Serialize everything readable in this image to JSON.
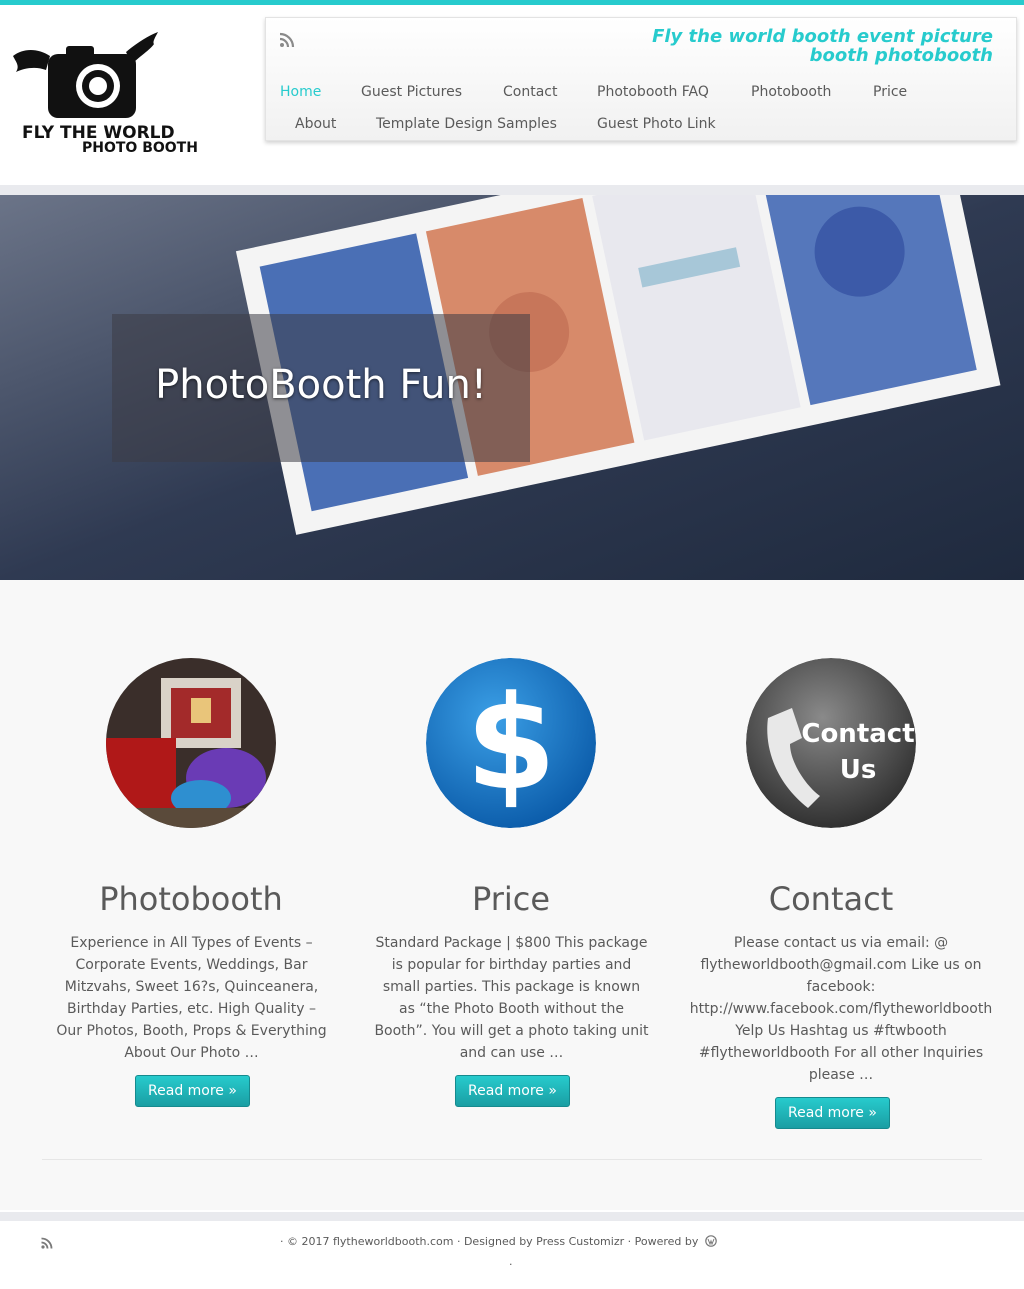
{
  "header": {
    "logo_line1": "FLY THE WORLD",
    "logo_line2": "PHOTO BOOTH",
    "tagline": "Fly the world booth event picture booth photobooth",
    "nav": {
      "home": "Home",
      "guest_pictures": "Guest Pictures",
      "contact": "Contact",
      "faq": "Photobooth FAQ",
      "photobooth": "Photobooth",
      "price": "Price",
      "about": "About",
      "templates": "Template Design Samples",
      "guest_photo_link": "Guest Photo Link"
    },
    "rss_icon": "rss-icon",
    "accent": "#27cbcd"
  },
  "hero": {
    "caption": "PhotoBooth Fun!"
  },
  "featured": [
    {
      "title": "Photobooth",
      "text": "Experience in All Types of Events – Corporate Events, Weddings, Bar Mitzvahs, Sweet 16?s, Quinceanera, Birthday Parties, etc. High Quality – Our Photos, Booth, Props & Everything About Our Photo …",
      "button": "Read more »"
    },
    {
      "title": "Price",
      "text": "Standard Package | $800 This package is popular for birthday parties and small parties. This package is known as “the Photo Booth without the Booth”. You will get a photo taking unit and can use …",
      "button": "Read more »",
      "icon_text": "$"
    },
    {
      "title": "Contact",
      "text": "Please contact us via email: @ flytheworldbooth@gmail.com Like us on facebook: http://www.facebook.com/flytheworldbooth Yelp Us Hashtag us #ftwbooth #flytheworldbooth For all other Inquiries please …",
      "button": "Read more »",
      "icon_line1": "Contact",
      "icon_line2": "Us"
    }
  ],
  "footer": {
    "text": "·  © 2017 flytheworldbooth.com ·  Designed by Press Customizr ·  Powered by",
    "dot": "·",
    "wordpress_icon": "wordpress-icon"
  }
}
